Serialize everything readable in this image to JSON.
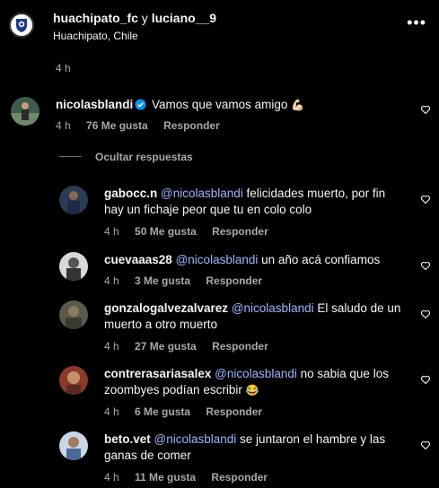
{
  "header": {
    "user1": "huachipato_fc",
    "conj": " y ",
    "user2": "luciano__9",
    "location": "Huachipato, Chile",
    "caption_time": "4 h",
    "more_icon": "more-horizontal-icon"
  },
  "main_comment": {
    "username": "nicolasblandi",
    "text": "Vamos que vamos amigo",
    "emoji": "💪🏻",
    "time": "4 h",
    "likes": "76 Me gusta",
    "reply": "Responder"
  },
  "hide_replies": "Ocultar respuestas",
  "replies": [
    {
      "username": "gabocc.n",
      "mention": "@nicolasblandi",
      "text_line1": " felicidades muerto, por fin",
      "text_line2": "hay un fichaje peor que tu en colo colo",
      "time": "4 h",
      "likes": "50 Me gusta",
      "reply": "Responder"
    },
    {
      "username": "cuevaaas28",
      "mention": "@nicolasblandi",
      "text_line1": " un año acá confiamos",
      "text_line2": "",
      "time": "4 h",
      "likes": "3 Me gusta",
      "reply": "Responder"
    },
    {
      "username": "gonzalogalvezalvarez",
      "mention": "@nicolasblandi",
      "text_line1": " El saludo de un",
      "text_line2": "muerto a otro muerto",
      "time": "4 h",
      "likes": "27 Me gusta",
      "reply": "Responder"
    },
    {
      "username": "contrerasariasalex",
      "mention": "@nicolasblandi",
      "text_line1": " no sabia que los",
      "text_line2": "zoombyes podían escribir",
      "emoji": "😂",
      "time": "4 h",
      "likes": "6 Me gusta",
      "reply": "Responder"
    },
    {
      "username": "beto.vet",
      "mention": "@nicolasblandi",
      "text_line1": " se juntaron el hambre y las",
      "text_line2": "ganas de comer",
      "time": "4 h",
      "likes": "11 Me gusta",
      "reply": "Responder"
    }
  ],
  "colors": {
    "background": "#000000",
    "text": "#f5f5f5",
    "secondary": "#a8a8a8",
    "mention": "#9fb4ff",
    "verified": "#0095f6"
  }
}
